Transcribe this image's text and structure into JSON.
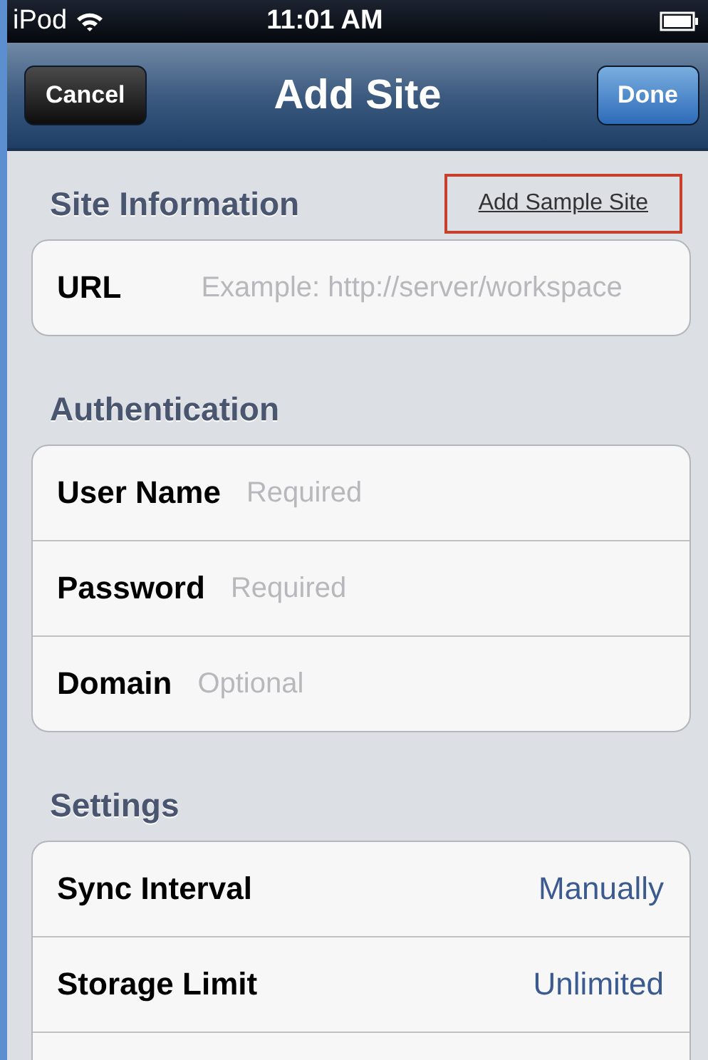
{
  "status_bar": {
    "carrier": "iPod",
    "time": "11:01 AM"
  },
  "nav_bar": {
    "title": "Add Site",
    "left_button": "Cancel",
    "right_button": "Done"
  },
  "sections": [
    {
      "title": "Site Information",
      "link": {
        "label": "Add Sample Site",
        "highlighted": true
      },
      "rows": [
        {
          "kind": "field",
          "label": "URL",
          "placeholder": "Example: http://server/workspace"
        }
      ]
    },
    {
      "title": "Authentication",
      "rows": [
        {
          "kind": "field",
          "label": "User Name",
          "placeholder": "Required"
        },
        {
          "kind": "field",
          "label": "Password",
          "placeholder": "Required"
        },
        {
          "kind": "field",
          "label": "Domain",
          "placeholder": "Optional"
        }
      ]
    },
    {
      "title": "Settings",
      "rows": [
        {
          "kind": "value",
          "label": "Sync Interval",
          "value": "Manually"
        },
        {
          "kind": "value",
          "label": "Storage Limit",
          "value": "Unlimited"
        }
      ]
    }
  ]
}
